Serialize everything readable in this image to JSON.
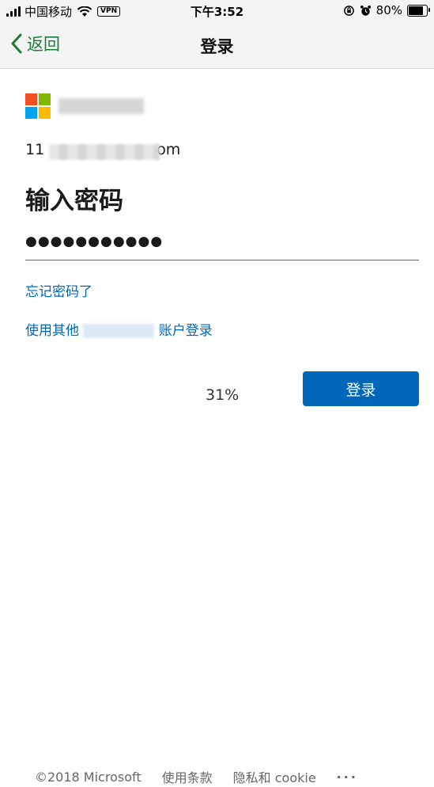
{
  "status_bar": {
    "carrier": "中国移动",
    "vpn_label": "VPN",
    "time": "下午3:52",
    "battery": "80%",
    "battery_level": 0.8
  },
  "nav": {
    "back_label": "返回",
    "title": "登录"
  },
  "brand": {
    "logo_colors": [
      "#f25022",
      "#7fba00",
      "#00a4ef",
      "#ffb900"
    ]
  },
  "account": {
    "prefix": "11",
    "suffix": "om"
  },
  "heading": "输入密码",
  "password": {
    "value": "●●●●●●●●●●●"
  },
  "links": {
    "forgot": "忘记密码了",
    "other_prefix": "使用其他",
    "other_suffix": "账户登录"
  },
  "progress_text": "31%",
  "signin_button": "登录",
  "footer": {
    "copyright": "©2018 Microsoft",
    "terms": "使用条款",
    "privacy": "隐私和 cookie",
    "more": "···"
  }
}
